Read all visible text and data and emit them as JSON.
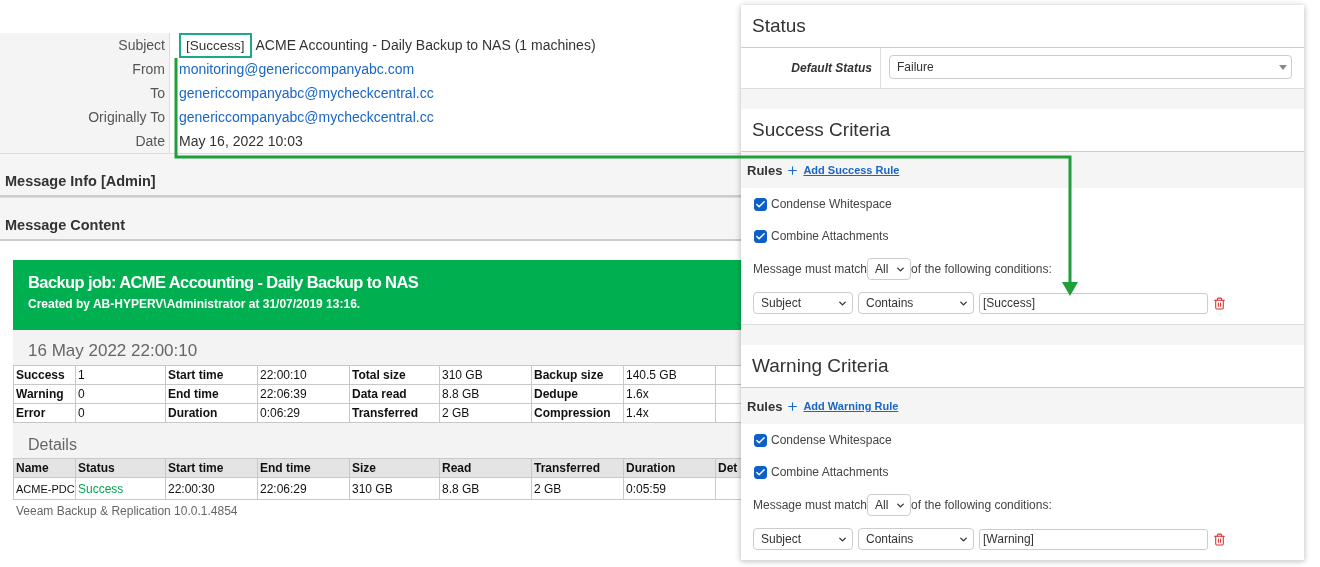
{
  "email": {
    "fields": [
      {
        "label": "Subject",
        "kind": "text",
        "tag": "[Success]",
        "value": "ACME Accounting - Daily Backup to NAS (1 machines)"
      },
      {
        "label": "From",
        "kind": "link",
        "value": "monitoring@genericcompanyabc.com"
      },
      {
        "label": "To",
        "kind": "link",
        "value": "genericcompanyabc@mycheckcentral.cc"
      },
      {
        "label": "Originally To",
        "kind": "link",
        "value": "genericcompanyabc@mycheckcentral.cc"
      },
      {
        "label": "Date",
        "kind": "text",
        "value": "May 16, 2022 10:03"
      }
    ],
    "sections": [
      "Message Info [Admin]",
      "Message Content"
    ]
  },
  "report": {
    "title": "Backup job: ACME Accounting - Daily Backup to NAS",
    "subtitle": "Created by AB-HYPERV\\Administrator at 31/07/2019 13:16.",
    "date": "16 May 2022 22:00:10",
    "summary": [
      [
        "Success",
        "1",
        "Start time",
        "22:00:10",
        "Total size",
        "310 GB",
        "Backup size",
        "140.5 GB"
      ],
      [
        "Warning",
        "0",
        "End time",
        "22:06:39",
        "Data read",
        "8.8 GB",
        "Dedupe",
        "1.6x"
      ],
      [
        "Error",
        "0",
        "Duration",
        "0:06:29",
        "Transferred",
        "2 GB",
        "Compression",
        "1.4x"
      ]
    ],
    "details_heading": "Details",
    "columns": [
      "Name",
      "Status",
      "Start time",
      "End time",
      "Size",
      "Read",
      "Transferred",
      "Duration",
      "Det"
    ],
    "rows": [
      {
        "color": "#00a94f",
        "cells": [
          "ACME-PDC",
          "Success",
          "22:00:30",
          "22:06:29",
          "310 GB",
          "8.8 GB",
          "2 GB",
          "0:05:59"
        ]
      }
    ],
    "footer": "Veeam Backup & Replication 10.0.1.4854"
  },
  "panel": {
    "status": {
      "title": "Status",
      "label": "Default Status",
      "value": "Failure"
    },
    "criteria": [
      {
        "title": "Success Criteria",
        "rules_label": "Rules",
        "add_rule": "Add Success Rule",
        "options": [
          {
            "label": "Condense Whitespace",
            "checked": true
          },
          {
            "label": "Combine Attachments",
            "checked": true
          }
        ],
        "match_prefix": "Message must match",
        "match_value": "All",
        "match_suffix": "of the following conditions:",
        "condition": {
          "field": "Subject",
          "operator": "Contains",
          "value": "[Success]"
        }
      },
      {
        "title": "Warning Criteria",
        "rules_label": "Rules",
        "add_rule": "Add Warning Rule",
        "options": [
          {
            "label": "Condense Whitespace",
            "checked": true
          },
          {
            "label": "Combine Attachments",
            "checked": true
          }
        ],
        "match_prefix": "Message must match",
        "match_value": "All",
        "match_suffix": "of the following conditions:",
        "condition": {
          "field": "Subject",
          "operator": "Contains",
          "value": "[Warning]"
        }
      }
    ]
  }
}
